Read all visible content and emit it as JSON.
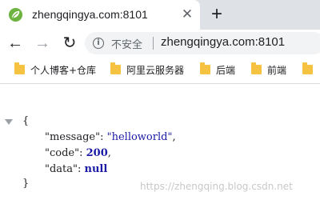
{
  "tab": {
    "title": "zhengqingya.com:8101",
    "close_glyph": "✕",
    "new_tab_glyph": "+",
    "favicon": "spring-leaf-icon"
  },
  "toolbar": {
    "back_glyph": "←",
    "forward_glyph": "→",
    "reload_glyph": "↻",
    "info_glyph": "i",
    "security_text": "不安全",
    "url": "zhengqingya.com:8101"
  },
  "bookmarks": [
    {
      "label": "个人博客+仓库"
    },
    {
      "label": "阿里云服务器"
    },
    {
      "label": "后端"
    },
    {
      "label": "前端"
    }
  ],
  "json_view": {
    "open_brace": "{",
    "close_brace": "}",
    "lines": [
      {
        "key": "\"message\":",
        "value": "\"helloworld\"",
        "suffix": ","
      },
      {
        "key": "\"code\":",
        "value": "200",
        "suffix": ","
      },
      {
        "key": "\"data\":",
        "value": "null",
        "suffix": ""
      }
    ]
  },
  "watermark": "https://zhengqing.blog.csdn.net",
  "colors": {
    "tabstrip": "#dee1e6",
    "omnibox": "#f1f3f4",
    "folder": "#f5c242",
    "json_value": "#1a1aa6",
    "favicon": "#6db33f"
  }
}
